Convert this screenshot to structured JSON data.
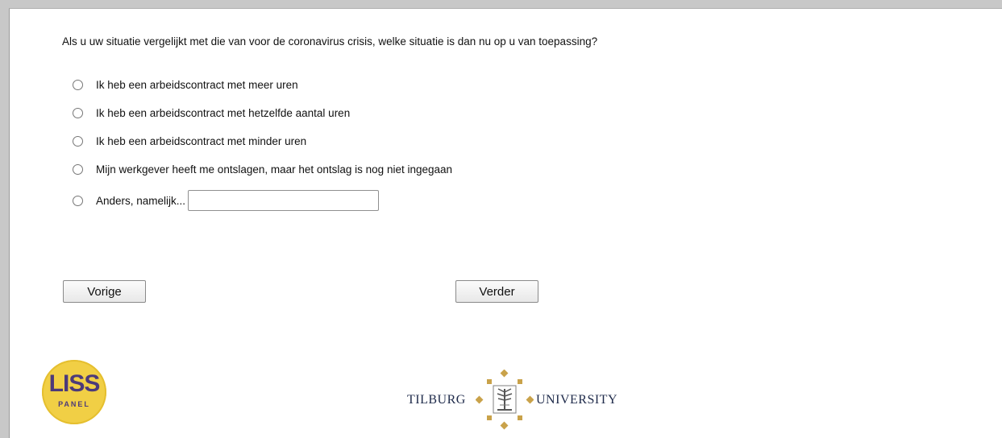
{
  "question": "Als u uw situatie vergelijkt met die van voor de coronavirus crisis, welke situatie is dan nu op u van toepassing?",
  "options": [
    "Ik heb een arbeidscontract met meer uren",
    "Ik heb een arbeidscontract met hetzelfde aantal uren",
    "Ik heb een arbeidscontract met minder uren",
    "Mijn werkgever heeft me ontslagen, maar het ontslag is nog niet ingegaan",
    "Anders, namelijk..."
  ],
  "other_input": {
    "value": ""
  },
  "buttons": {
    "previous": "Vorige",
    "next": "Verder"
  },
  "logos": {
    "liss_main": "LISS",
    "liss_sub": "PANEL",
    "tilburg_left": "TILBURG",
    "tilburg_right": "UNIVERSITY"
  },
  "colors": {
    "liss_yellow": "#f1cf45",
    "liss_purple": "#4c3a7a",
    "tilburg_gold": "#c9a24a",
    "tilburg_navy": "#1e2a4a"
  }
}
